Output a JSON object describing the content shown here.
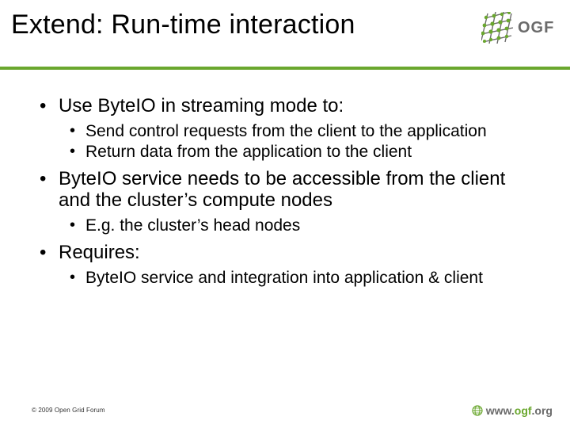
{
  "header": {
    "title": "Extend: Run-time interaction",
    "logo_text": "OGF"
  },
  "bullets": [
    {
      "text": "Use ByteIO in streaming mode to:",
      "sub": [
        "Send control requests from the client to the application",
        "Return data from the application to the client"
      ]
    },
    {
      "text": "ByteIO service needs to be accessible from the client and the cluster’s compute nodes",
      "sub": [
        "E.g. the cluster’s head nodes"
      ]
    },
    {
      "text": "Requires:",
      "sub": [
        "ByteIO service and integration into application & client"
      ]
    }
  ],
  "footer": {
    "copyright": "© 2009 Open Grid Forum",
    "url_www": "www.",
    "url_ogf": "ogf",
    "url_org": ".org"
  }
}
